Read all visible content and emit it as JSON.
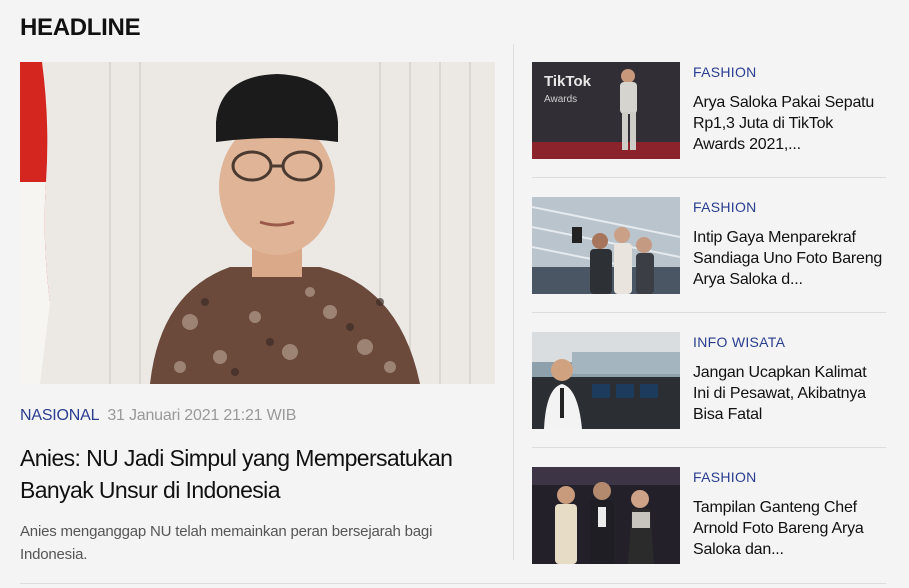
{
  "section": {
    "title": "HEADLINE"
  },
  "headline": {
    "category": "NASIONAL",
    "date": "31 Januari 2021 21:21 WIB",
    "title": "Anies: NU Jadi Simpul yang Mempersatukan Banyak Unsur di Indonesia",
    "description": "Anies menganggap NU telah memainkan peran bersejarah bagi Indonesia."
  },
  "side_articles": [
    {
      "category": "FASHION",
      "title": "Arya Saloka Pakai Sepatu Rp1,3 Juta di TikTok Awards 2021,..."
    },
    {
      "category": "FASHION",
      "title": "Intip Gaya Menparekraf Sandiaga Uno Foto Bareng Arya Saloka d..."
    },
    {
      "category": "INFO WISATA",
      "title": "Jangan Ucapkan Kalimat Ini di Pesawat, Akibatnya Bisa Fatal"
    },
    {
      "category": "FASHION",
      "title": "Tampilan Ganteng Chef Arnold Foto Bareng Arya Saloka dan..."
    }
  ],
  "thumb_text": {
    "tiktok_brand": "TikTok",
    "tiktok_sub": "Awards"
  },
  "colors": {
    "category": "#2a3d8f",
    "background": "#f4f4f4"
  }
}
